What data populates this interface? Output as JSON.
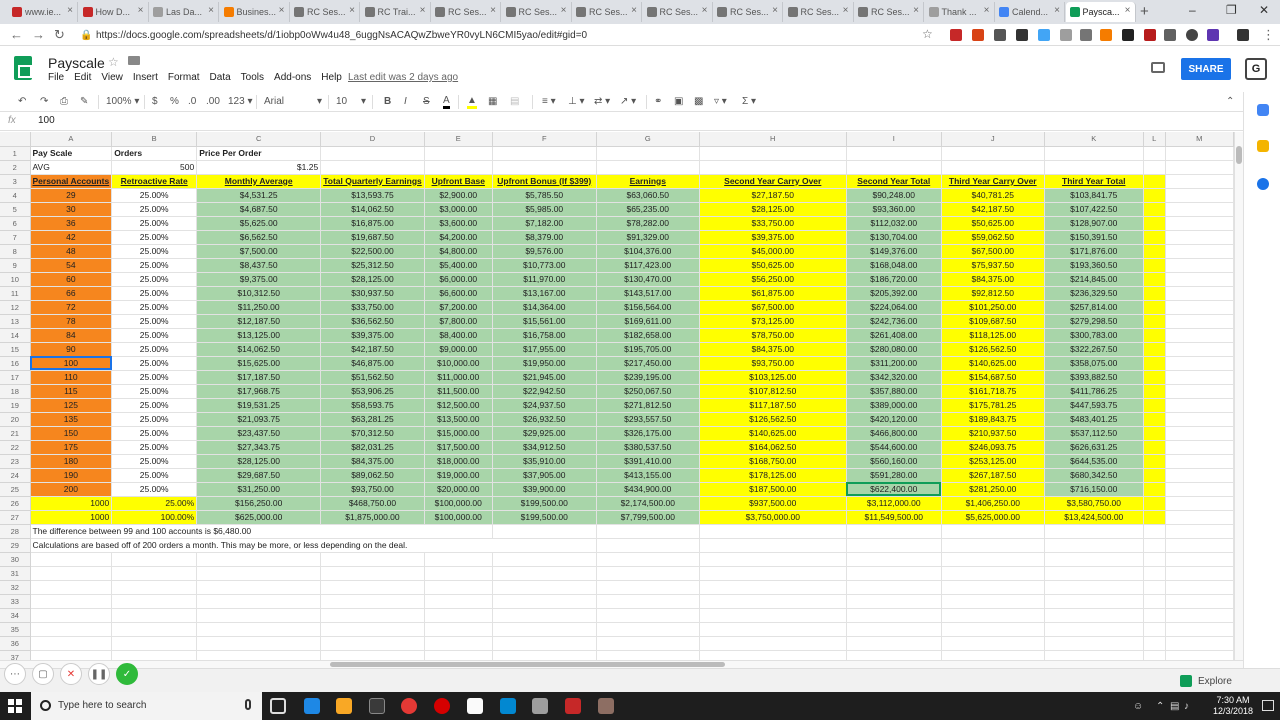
{
  "browser": {
    "tabs": [
      {
        "label": "www.ie..."
      },
      {
        "label": "How D..."
      },
      {
        "label": "Las Da..."
      },
      {
        "label": "Busines..."
      },
      {
        "label": "RC Ses..."
      },
      {
        "label": "RC Trai..."
      },
      {
        "label": "RC Ses..."
      },
      {
        "label": "RC Ses..."
      },
      {
        "label": "RC Ses..."
      },
      {
        "label": "RC Ses..."
      },
      {
        "label": "RC Ses..."
      },
      {
        "label": "RC Ses..."
      },
      {
        "label": "RC Ses..."
      },
      {
        "label": "Thank ..."
      },
      {
        "label": "Calend..."
      },
      {
        "label": "Paysca..."
      }
    ],
    "url": "https://docs.google.com/spreadsheets/d/1iobp0oWw4u48_6uggNsACAQwZbweYR0vyLN6CMI5yao/edit#gid=0"
  },
  "sheets": {
    "title": "Payscale",
    "menu": [
      "File",
      "Edit",
      "View",
      "Insert",
      "Format",
      "Data",
      "Tools",
      "Add-ons",
      "Help"
    ],
    "last_edit": "Last edit was 2 days ago",
    "share_label": "SHARE",
    "account_initial": "G",
    "toolbar": {
      "zoom": "100%",
      "currency": "$",
      "percent": "%",
      "dec_less": ".0",
      "dec_more": ".00",
      "format": "123",
      "font": "Arial",
      "font_size": "10",
      "bold": "B",
      "italic": "I",
      "strike": "S",
      "text_color": "A"
    },
    "fx_label": "fx",
    "fx_value": "100",
    "explore_label": "Explore"
  },
  "grid": {
    "columns": [
      "A",
      "B",
      "C",
      "D",
      "E",
      "F",
      "G",
      "H",
      "I",
      "J",
      "K",
      "L",
      "M"
    ],
    "row1": {
      "a": "Pay Scale",
      "b": "Orders",
      "c": "Price Per Order"
    },
    "row2": {
      "a": "AVG",
      "b": "500",
      "c": "$1.25"
    },
    "headers": [
      "Personal Accounts",
      "Retroactive Rate",
      "Monthly Average",
      "Total Quarterly Earnings",
      "Upfront Base",
      "Upfront Bonus (If $399)",
      "Earnings",
      "Second Year Carry Over",
      "Second Year Total",
      "Third Year Carry Over",
      "Third Year Total"
    ],
    "rows": [
      [
        "29",
        "25.00%",
        "$4,531.25",
        "$13,593.75",
        "$2,900.00",
        "$5,785.50",
        "$63,060.50",
        "$27,187.50",
        "$90,248.00",
        "$40,781.25",
        "$103,841.75"
      ],
      [
        "30",
        "25.00%",
        "$4,687.50",
        "$14,062.50",
        "$3,000.00",
        "$5,985.00",
        "$65,235.00",
        "$28,125.00",
        "$93,360.00",
        "$42,187.50",
        "$107,422.50"
      ],
      [
        "36",
        "25.00%",
        "$5,625.00",
        "$16,875.00",
        "$3,600.00",
        "$7,182.00",
        "$78,282.00",
        "$33,750.00",
        "$112,032.00",
        "$50,625.00",
        "$128,907.00"
      ],
      [
        "42",
        "25.00%",
        "$6,562.50",
        "$19,687.50",
        "$4,200.00",
        "$8,379.00",
        "$91,329.00",
        "$39,375.00",
        "$130,704.00",
        "$59,062.50",
        "$150,391.50"
      ],
      [
        "48",
        "25.00%",
        "$7,500.00",
        "$22,500.00",
        "$4,800.00",
        "$9,576.00",
        "$104,376.00",
        "$45,000.00",
        "$149,376.00",
        "$67,500.00",
        "$171,876.00"
      ],
      [
        "54",
        "25.00%",
        "$8,437.50",
        "$25,312.50",
        "$5,400.00",
        "$10,773.00",
        "$117,423.00",
        "$50,625.00",
        "$168,048.00",
        "$75,937.50",
        "$193,360.50"
      ],
      [
        "60",
        "25.00%",
        "$9,375.00",
        "$28,125.00",
        "$6,000.00",
        "$11,970.00",
        "$130,470.00",
        "$56,250.00",
        "$186,720.00",
        "$84,375.00",
        "$214,845.00"
      ],
      [
        "66",
        "25.00%",
        "$10,312.50",
        "$30,937.50",
        "$6,600.00",
        "$13,167.00",
        "$143,517.00",
        "$61,875.00",
        "$205,392.00",
        "$92,812.50",
        "$236,329.50"
      ],
      [
        "72",
        "25.00%",
        "$11,250.00",
        "$33,750.00",
        "$7,200.00",
        "$14,364.00",
        "$156,564.00",
        "$67,500.00",
        "$224,064.00",
        "$101,250.00",
        "$257,814.00"
      ],
      [
        "78",
        "25.00%",
        "$12,187.50",
        "$36,562.50",
        "$7,800.00",
        "$15,561.00",
        "$169,611.00",
        "$73,125.00",
        "$242,736.00",
        "$109,687.50",
        "$279,298.50"
      ],
      [
        "84",
        "25.00%",
        "$13,125.00",
        "$39,375.00",
        "$8,400.00",
        "$16,758.00",
        "$182,658.00",
        "$78,750.00",
        "$261,408.00",
        "$118,125.00",
        "$300,783.00"
      ],
      [
        "90",
        "25.00%",
        "$14,062.50",
        "$42,187.50",
        "$9,000.00",
        "$17,955.00",
        "$195,705.00",
        "$84,375.00",
        "$280,080.00",
        "$126,562.50",
        "$322,267.50"
      ],
      [
        "100",
        "25.00%",
        "$15,625.00",
        "$46,875.00",
        "$10,000.00",
        "$19,950.00",
        "$217,450.00",
        "$93,750.00",
        "$311,200.00",
        "$140,625.00",
        "$358,075.00"
      ],
      [
        "110",
        "25.00%",
        "$17,187.50",
        "$51,562.50",
        "$11,000.00",
        "$21,945.00",
        "$239,195.00",
        "$103,125.00",
        "$342,320.00",
        "$154,687.50",
        "$393,882.50"
      ],
      [
        "115",
        "25.00%",
        "$17,968.75",
        "$53,906.25",
        "$11,500.00",
        "$22,942.50",
        "$250,067.50",
        "$107,812.50",
        "$357,880.00",
        "$161,718.75",
        "$411,786.25"
      ],
      [
        "125",
        "25.00%",
        "$19,531.25",
        "$58,593.75",
        "$12,500.00",
        "$24,937.50",
        "$271,812.50",
        "$117,187.50",
        "$389,000.00",
        "$175,781.25",
        "$447,593.75"
      ],
      [
        "135",
        "25.00%",
        "$21,093.75",
        "$63,281.25",
        "$13,500.00",
        "$26,932.50",
        "$293,557.50",
        "$126,562.50",
        "$420,120.00",
        "$189,843.75",
        "$483,401.25"
      ],
      [
        "150",
        "25.00%",
        "$23,437.50",
        "$70,312.50",
        "$15,000.00",
        "$29,925.00",
        "$326,175.00",
        "$140,625.00",
        "$466,800.00",
        "$210,937.50",
        "$537,112.50"
      ],
      [
        "175",
        "25.00%",
        "$27,343.75",
        "$82,031.25",
        "$17,500.00",
        "$34,912.50",
        "$380,537.50",
        "$164,062.50",
        "$544,600.00",
        "$246,093.75",
        "$626,631.25"
      ],
      [
        "180",
        "25.00%",
        "$28,125.00",
        "$84,375.00",
        "$18,000.00",
        "$35,910.00",
        "$391,410.00",
        "$168,750.00",
        "$560,160.00",
        "$253,125.00",
        "$644,535.00"
      ],
      [
        "190",
        "25.00%",
        "$29,687.50",
        "$89,062.50",
        "$19,000.00",
        "$37,905.00",
        "$413,155.00",
        "$178,125.00",
        "$591,280.00",
        "$267,187.50",
        "$680,342.50"
      ],
      [
        "200",
        "25.00%",
        "$31,250.00",
        "$93,750.00",
        "$20,000.00",
        "$39,900.00",
        "$434,900.00",
        "$187,500.00",
        "$622,400.00",
        "$281,250.00",
        "$716,150.00"
      ]
    ],
    "total_rows": [
      [
        "1000",
        "25.00%",
        "$156,250.00",
        "$468,750.00",
        "$100,000.00",
        "$199,500.00",
        "$2,174,500.00",
        "$937,500.00",
        "$3,112,000.00",
        "$1,406,250.00",
        "$3,580,750.00"
      ],
      [
        "1000",
        "100.00%",
        "$625,000.00",
        "$1,875,000.00",
        "$100,000.00",
        "$199,500.00",
        "$7,799,500.00",
        "$3,750,000.00",
        "$11,549,500.00",
        "$5,625,000.00",
        "$13,424,500.00"
      ]
    ],
    "note1": "The difference between 99 and 100 accounts is $6,480.00",
    "note2": "Calculations are based off of 200 orders a month. This may be more, or less depending on the deal.",
    "empty_rows": [
      "30",
      "31",
      "32",
      "33",
      "34",
      "35",
      "36",
      "37"
    ]
  },
  "taskbar": {
    "search_placeholder": "Type here to search",
    "time": "7:30 AM",
    "date": "12/3/2018"
  },
  "colors": {
    "orange": "#f6861e",
    "yellow": "#ffff00",
    "green": "#a8d5a9",
    "accent": "#1a73e8"
  }
}
